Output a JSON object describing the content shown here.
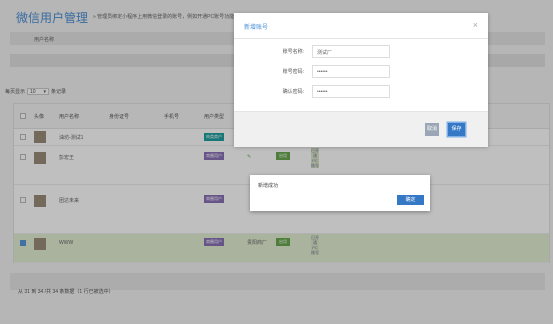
{
  "header": {
    "title": "微信用户管理",
    "subtitle": "» 管理员绑定小程序上用微信登录的账号，例如开通PC账号功能"
  },
  "filter": {
    "label": "用户名称"
  },
  "paging": {
    "prefix": "每页显示",
    "size": "10",
    "suffix": "条记录"
  },
  "table": {
    "columns": [
      "头像",
      "用户名称",
      "身份证号",
      "手机号",
      "用户类型"
    ],
    "rows": [
      {
        "name": "油坊-测试1",
        "type": "肉类商户",
        "type_color": "#21a0a0",
        "selected": false
      },
      {
        "name": "彭宏王",
        "type": "商圈用户",
        "type_color": "#8a72b8",
        "status": "启用",
        "vertical": "已开通PC账号",
        "selected": false
      },
      {
        "name": "团达未来",
        "type": "商圈用户",
        "type_color": "#8a72b8",
        "status": "启用",
        "vertical": "已开通PC账号",
        "selected": false
      },
      {
        "name": "WWW",
        "type": "商圈用户",
        "type_color": "#8a72b8",
        "extra": "贵阳商厂",
        "status": "启用",
        "vertical": "已开通PC账号",
        "selected": true
      }
    ]
  },
  "footer": {
    "text": "从 31 到 34 /共 34 条数据（1 行已被选中）"
  },
  "modal": {
    "title": "新增账号",
    "close_icon": "close-icon",
    "fields": [
      {
        "label": "账号名称:",
        "value": "测试厂"
      },
      {
        "label": "账号密码:",
        "value": "••••••"
      },
      {
        "label": "确认密码:",
        "value": "••••••"
      }
    ],
    "cancel_label": "取消",
    "save_label": "保存"
  },
  "alert": {
    "message": "新增成功",
    "confirm_label": "确定"
  }
}
